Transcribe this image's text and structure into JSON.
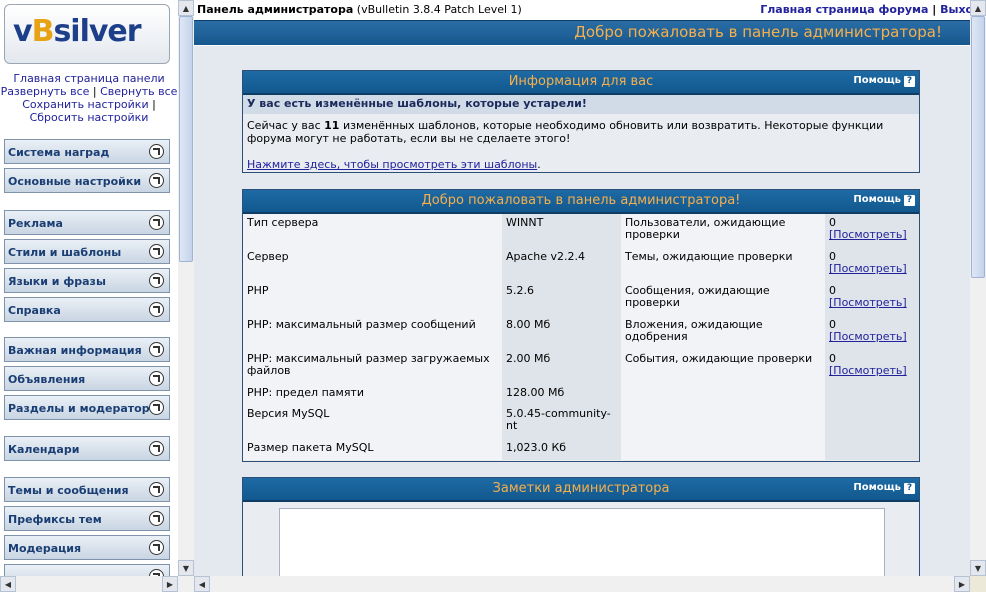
{
  "nav": {
    "logo": {
      "v": "v",
      "b": "B",
      "silver": "silver"
    },
    "links": [
      "Главная страница панели",
      "Развернуть все",
      "Свернуть все",
      "Сохранить настройки",
      "Сбросить настройки"
    ],
    "groups": [
      [
        "Система наград",
        "Основные настройки"
      ],
      [
        "Реклама",
        "Стили и шаблоны",
        "Языки и фразы",
        "Справка"
      ],
      [
        "Важная информация",
        "Объявления",
        "Разделы и модераторы"
      ],
      [
        "Календари"
      ],
      [
        "Темы и сообщения",
        "Префиксы тем",
        "Модерация",
        ""
      ]
    ]
  },
  "topbar": {
    "title_bold": "Панель администратора",
    "title_rest": " (vBulletin 3.8.4 Patch Level 1)",
    "forum_home": "Главная страница форума",
    "sep": "|",
    "logout": "Выход"
  },
  "welcome_bar": "Добро пожаловать в панель администратора!",
  "help_label": "Помощь",
  "info": {
    "title": "Информация для вас",
    "subtitle": "У вас есть изменённые шаблоны, которые устарели!",
    "text_before": "Сейчас у вас ",
    "count": "11",
    "text_after": " изменённых шаблонов, которые необходимо обновить или возвратить. Некоторые функции форума могут не работать, если вы не сделаете этого!",
    "link": "Нажмите здесь, чтобы просмотреть эти шаблоны",
    "link_tail": "."
  },
  "stats": {
    "title": "Добро пожаловать в панель администратора!",
    "view_link": "[Посмотреть]",
    "rows": [
      {
        "label": "Тип сервера",
        "value": "WINNT",
        "mod_label": "Пользователи, ожидающие проверки",
        "mod_count": "0"
      },
      {
        "label": "Сервер",
        "value": "Apache v2.2.4",
        "mod_label": "Темы, ожидающие проверки",
        "mod_count": "0"
      },
      {
        "label": "PHP",
        "value": "5.2.6",
        "mod_label": "Сообщения, ожидающие проверки",
        "mod_count": "0"
      },
      {
        "label": "PHP: максимальный размер сообщений",
        "value": "8.00 Мб",
        "mod_label": "Вложения, ожидающие одобрения",
        "mod_count": "0"
      },
      {
        "label": "PHP: максимальный размер загружаемых файлов",
        "value": "2.00 Мб",
        "mod_label": "События, ожидающие проверки",
        "mod_count": "0"
      },
      {
        "label": "PHP: предел памяти",
        "value": "128.00 Мб",
        "mod_label": "",
        "mod_count": ""
      },
      {
        "label": "Версия MySQL",
        "value": "5.0.45-community-nt",
        "mod_label": "",
        "mod_count": ""
      },
      {
        "label": "Размер пакета MySQL",
        "value": "1,023.0 Кб",
        "mod_label": "",
        "mod_count": ""
      }
    ]
  },
  "notes": {
    "title": "Заметки администратора"
  }
}
